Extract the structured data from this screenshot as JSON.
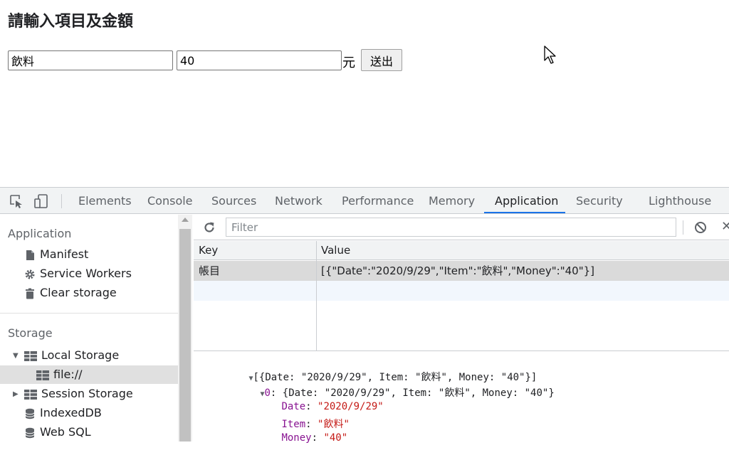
{
  "page": {
    "heading": "請輸入項目及金額",
    "item_value": "飲料",
    "money_value": "40",
    "unit": "元",
    "submit_label": "送出"
  },
  "devtools": {
    "tabs": [
      {
        "label": "Elements"
      },
      {
        "label": "Console"
      },
      {
        "label": "Sources"
      },
      {
        "label": "Network"
      },
      {
        "label": "Performance"
      },
      {
        "label": "Memory"
      },
      {
        "label": "Application"
      },
      {
        "label": "Security"
      },
      {
        "label": "Lighthouse"
      }
    ],
    "active_tab": "Application",
    "sidebar": {
      "application_header": "Application",
      "application_items": [
        {
          "label": "Manifest",
          "icon": "document-icon"
        },
        {
          "label": "Service Workers",
          "icon": "gear-icon"
        },
        {
          "label": "Clear storage",
          "icon": "trash-icon"
        }
      ],
      "storage_header": "Storage",
      "local_storage": "Local Storage",
      "local_storage_child": "file://",
      "session_storage": "Session Storage",
      "indexeddb": "IndexedDB",
      "websql": "Web SQL"
    },
    "toolbar": {
      "filter_placeholder": "Filter"
    },
    "table": {
      "key_header": "Key",
      "value_header": "Value",
      "rows": [
        {
          "key": "帳目",
          "value": "[{\"Date\":\"2020/9/29\",\"Item\":\"飲料\",\"Money\":\"40\"}]"
        }
      ]
    },
    "preview": {
      "root": "[{Date: \"2020/9/29\", Item: \"飲料\", Money: \"40\"}]",
      "item0": "{Date: \"2020/9/29\", Item: \"飲料\", Money: \"40\"}",
      "item0_index": "0",
      "fields": [
        {
          "key": "Date",
          "value": "\"2020/9/29\""
        },
        {
          "key": "Item",
          "value": "\"飲料\""
        },
        {
          "key": "Money",
          "value": "\"40\""
        }
      ]
    },
    "colors": {
      "accent": "#1a73e8",
      "key_purple": "#881391",
      "string_red": "#c41a16"
    }
  }
}
